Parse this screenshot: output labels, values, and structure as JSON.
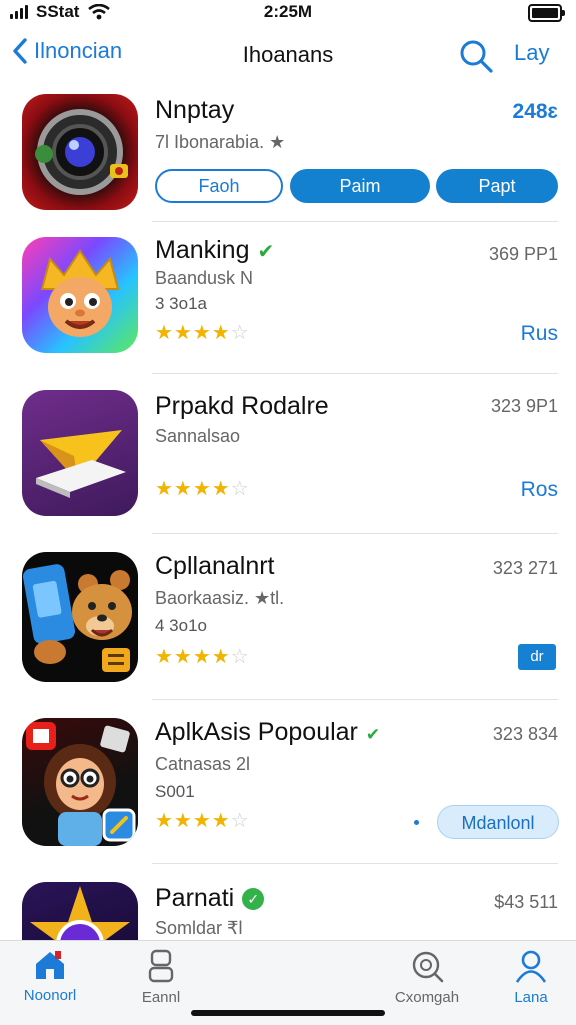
{
  "status_bar": {
    "carrier": "SStat",
    "time": "2:25M"
  },
  "nav": {
    "back_label": "Ilnoncian",
    "title": "Ihoanans",
    "right_label": "Lay"
  },
  "apps": [
    {
      "name": "Nnptay",
      "subtitle": "7l Ibonarabia. ★",
      "meta": "248ɛ",
      "buttons": [
        "Faoh",
        "Paim",
        "Papt"
      ]
    },
    {
      "name": "Manking",
      "subtitle": "Baandusk N",
      "third": "3 3o1a",
      "stars": "★★★★",
      "stars_empty": "☆",
      "meta": "369 PP1",
      "action": "Rus"
    },
    {
      "name": "Prpakd Rodalre",
      "subtitle": "Sannalsao",
      "stars": "★★★★",
      "stars_empty": "☆",
      "meta": "323 9P1",
      "action": "Ros"
    },
    {
      "name": "Cpllanalnrt",
      "subtitle": "Baorkaasiz. ★tl.",
      "third": "4 3o1o",
      "stars": "★★★★",
      "stars_empty": "☆",
      "meta": "323 271",
      "action": "dr"
    },
    {
      "name": "AplkAsis Popoular",
      "subtitle": "Catnasas 2l",
      "third": "S001",
      "stars": "★★★★",
      "stars_empty": "☆",
      "meta": "323 834",
      "action": "Mdanlonl"
    },
    {
      "name": "Parnati",
      "subtitle": "Somldar ₹l",
      "meta": "$43 511"
    }
  ],
  "tabs": [
    {
      "label": "Noonorl",
      "icon": "home-icon",
      "active": true
    },
    {
      "label": "Eannl",
      "icon": "profile-box-icon",
      "active": false
    },
    {
      "label": "Cxomgah",
      "icon": "search-icon",
      "active": false
    },
    {
      "label": "Lana",
      "icon": "person-icon",
      "active": false
    }
  ],
  "colors": {
    "accent": "#1b7bd6",
    "star": "#f2b400",
    "check": "#2eaa3b"
  }
}
